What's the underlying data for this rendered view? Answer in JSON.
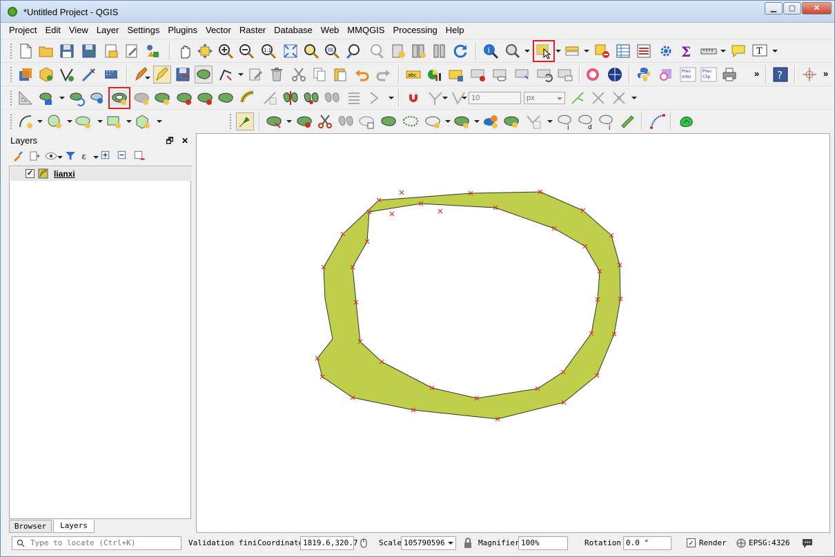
{
  "window": {
    "title": "*Untitled Project - QGIS"
  },
  "menubar": [
    "Project",
    "Edit",
    "View",
    "Layer",
    "Settings",
    "Plugins",
    "Vector",
    "Raster",
    "Database",
    "Web",
    "MMQGIS",
    "Processing",
    "Help"
  ],
  "toolbar": {
    "snap_tolerance": "10",
    "snap_unit": "px",
    "labels": {
      "abc": "abc",
      "prev_inter": "Prev\nInter",
      "prev_clip": "Prev\nClip"
    }
  },
  "layers_panel": {
    "title": "Layers",
    "layers": [
      {
        "name": "lianxi",
        "checked": true
      }
    ]
  },
  "tabs": [
    "Browser",
    "Layers"
  ],
  "status": {
    "locate_placeholder": "Type to locate (Ctrl+K)",
    "validation": "Validation fini",
    "coordinate_label": "Coordinate",
    "coordinate": "1819.6,320.7",
    "scale_label": "Scale",
    "scale": "105790596",
    "magnifier_label": "Magnifier",
    "magnifier": "100%",
    "rotation_label": "Rotation",
    "rotation": "0.0 °",
    "render_label": "Render",
    "crs": "EPSG:4326"
  },
  "colors": {
    "polygon_fill": "#bfcf4a",
    "vertex_marker": "#e03020",
    "highlight": "#e02020"
  }
}
